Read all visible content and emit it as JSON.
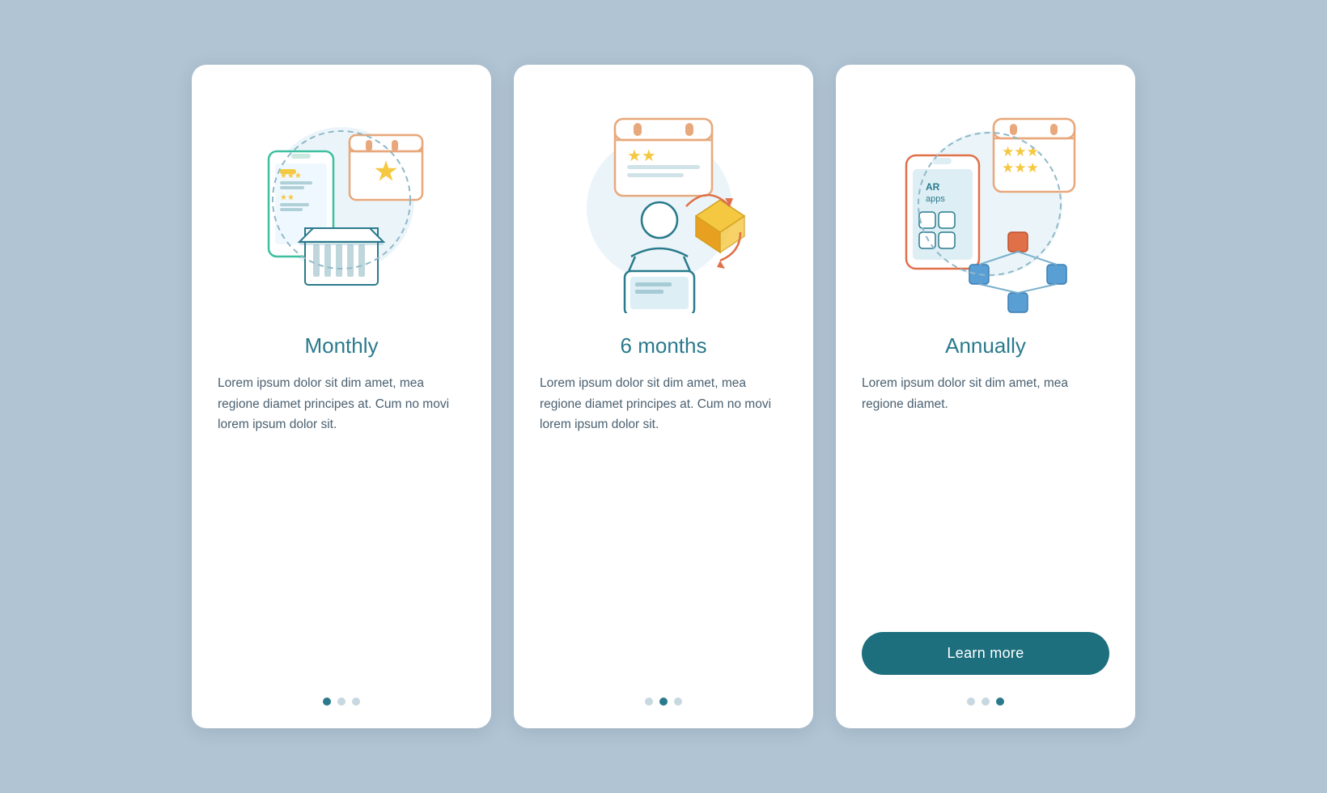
{
  "cards": [
    {
      "id": "monthly",
      "title": "Monthly",
      "text": "Lorem ipsum dolor sit dim amet, mea regione diamet principes at. Cum no movi lorem ipsum dolor sit.",
      "dots": [
        "active",
        "inactive",
        "inactive"
      ],
      "button": null
    },
    {
      "id": "six-months",
      "title": "6 months",
      "text": "Lorem ipsum dolor sit dim amet, mea regione diamet principes at. Cum no movi lorem ipsum dolor sit.",
      "dots": [
        "inactive",
        "active",
        "inactive"
      ],
      "button": null
    },
    {
      "id": "annually",
      "title": "Annually",
      "text": "Lorem ipsum dolor sit dim amet, mea regione diamet.",
      "dots": [
        "inactive",
        "inactive",
        "active"
      ],
      "button": "Learn more"
    }
  ]
}
